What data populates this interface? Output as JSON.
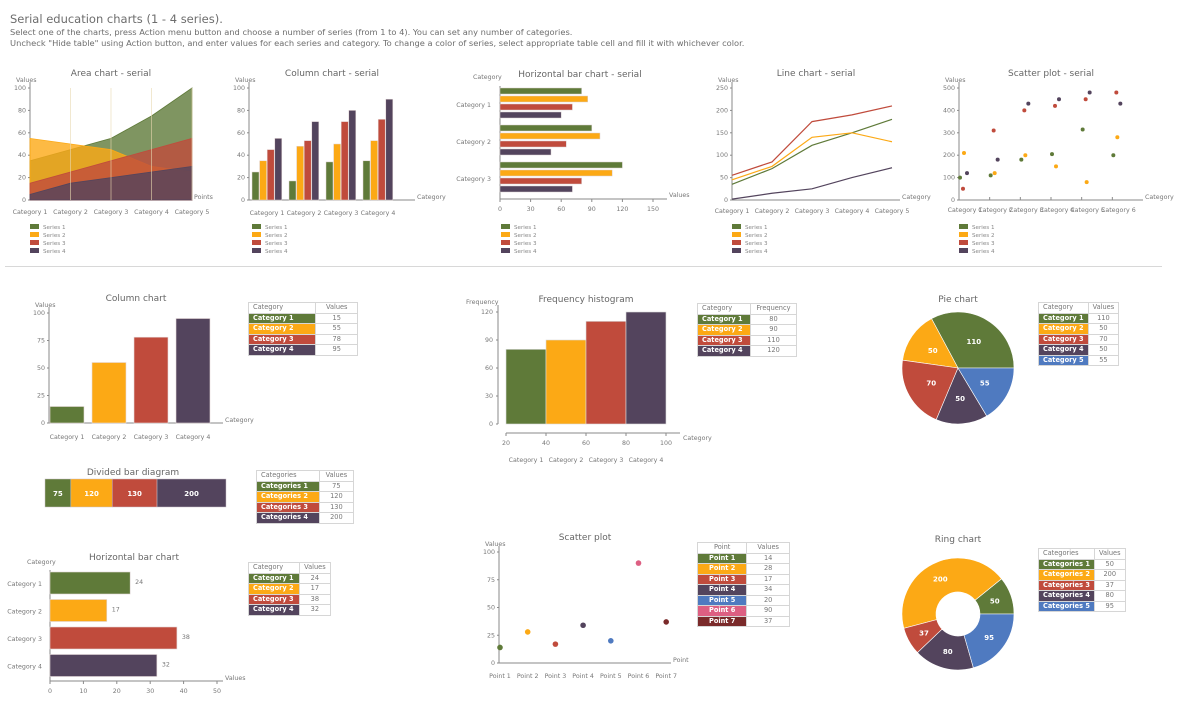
{
  "header": {
    "title": "Serial education charts (1 - 4 series).",
    "line1": "Select one of the charts, press Action menu button and choose a number of series (from 1 to 4). You can set any number of categories.",
    "line2": "Uncheck \"Hide table\" using Action button, and enter values for each series and category. To change a color of series, select appropriate table cell and fill it with whichever color."
  },
  "colors": {
    "green": "#5f7a39",
    "orange": "#fca915",
    "red": "#c04b3c",
    "purple": "#53445d",
    "blue": "#4f7ac0",
    "pink": "#dd5f82",
    "maroon": "#7a2a2a",
    "axis": "#8a8a8a"
  },
  "chart_data": [
    {
      "id": "area_serial",
      "type": "area",
      "title": "Area chart - serial",
      "ylabel": "Values",
      "xlabel": "Points",
      "ylim": [
        0,
        100
      ],
      "yticks": [
        0,
        20,
        40,
        60,
        80,
        100
      ],
      "categories": [
        "Category 1",
        "Category 2",
        "Category 3",
        "Category 4",
        "Category 5"
      ],
      "series": [
        {
          "name": "Series 1",
          "color": "#5f7a39",
          "values": [
            35,
            45,
            55,
            75,
            100
          ]
        },
        {
          "name": "Series 2",
          "color": "#fca915",
          "values": [
            55,
            50,
            45,
            30,
            25
          ]
        },
        {
          "name": "Series 3",
          "color": "#c04b3c",
          "values": [
            15,
            25,
            35,
            45,
            55
          ]
        },
        {
          "name": "Series 4",
          "color": "#53445d",
          "values": [
            5,
            15,
            20,
            25,
            30
          ]
        }
      ],
      "legend": "bottom-left"
    },
    {
      "id": "column_serial",
      "type": "bar",
      "title": "Column chart - serial",
      "ylabel": "Values",
      "xlabel": "Category",
      "ylim": [
        0,
        100
      ],
      "yticks": [
        0,
        20,
        40,
        60,
        80,
        100
      ],
      "categories": [
        "Category 1",
        "Category 2",
        "Category 3",
        "Category 4"
      ],
      "series": [
        {
          "name": "Series 1",
          "color": "#5f7a39",
          "values": [
            25,
            17,
            34,
            35
          ]
        },
        {
          "name": "Series 2",
          "color": "#fca915",
          "values": [
            35,
            48,
            50,
            53
          ]
        },
        {
          "name": "Series 3",
          "color": "#c04b3c",
          "values": [
            45,
            53,
            70,
            72
          ]
        },
        {
          "name": "Series 4",
          "color": "#53445d",
          "values": [
            55,
            70,
            80,
            90
          ]
        }
      ],
      "legend": "bottom-left"
    },
    {
      "id": "hbar_serial",
      "type": "bar",
      "orientation": "horizontal",
      "title": "Horizontal bar chart - serial",
      "ylabel": "Category",
      "xlabel": "Values",
      "xlim": [
        0,
        150
      ],
      "xticks": [
        0,
        30,
        60,
        90,
        120,
        150
      ],
      "categories": [
        "Category 1",
        "Category 2",
        "Category 3"
      ],
      "series": [
        {
          "name": "Series 1",
          "color": "#5f7a39",
          "values": [
            80,
            90,
            120
          ]
        },
        {
          "name": "Series 2",
          "color": "#fca915",
          "values": [
            86,
            98,
            110
          ]
        },
        {
          "name": "Series 3",
          "color": "#c04b3c",
          "values": [
            71,
            65,
            80
          ]
        },
        {
          "name": "Series 4",
          "color": "#53445d",
          "values": [
            60,
            50,
            71
          ]
        }
      ],
      "legend": "bottom-left"
    },
    {
      "id": "line_serial",
      "type": "line",
      "title": "Line chart - serial",
      "ylabel": "Values",
      "xlabel": "Category",
      "ylim": [
        0,
        250
      ],
      "yticks": [
        0,
        50,
        100,
        150,
        200,
        250
      ],
      "categories": [
        "Category 1",
        "Category 2",
        "Category 3",
        "Category 4",
        "Category 5"
      ],
      "series": [
        {
          "name": "Series 1",
          "color": "#5f7a39",
          "values": [
            35,
            70,
            122,
            150,
            180
          ]
        },
        {
          "name": "Series 2",
          "color": "#fca915",
          "values": [
            45,
            75,
            140,
            150,
            130
          ]
        },
        {
          "name": "Series 3",
          "color": "#c04b3c",
          "values": [
            55,
            85,
            175,
            190,
            210
          ]
        },
        {
          "name": "Series 4",
          "color": "#53445d",
          "values": [
            2,
            15,
            25,
            50,
            72
          ]
        }
      ],
      "legend": "bottom-left"
    },
    {
      "id": "scatter_serial",
      "type": "scatter",
      "title": "Scatter plot - serial",
      "ylabel": "Values",
      "xlabel": "Category",
      "ylim": [
        0,
        500
      ],
      "yticks": [
        0,
        100,
        200,
        300,
        400,
        500
      ],
      "categories": [
        "Category 1",
        "Category 2",
        "Category 3",
        "Category 4",
        "Category 5",
        "Category 6"
      ],
      "series": [
        {
          "name": "Series 1",
          "color": "#5f7a39",
          "values": [
            100,
            110,
            180,
            205,
            315,
            200
          ]
        },
        {
          "name": "Series 2",
          "color": "#fca915",
          "values": [
            210,
            120,
            200,
            150,
            80,
            280
          ]
        },
        {
          "name": "Series 3",
          "color": "#c04b3c",
          "values": [
            50,
            310,
            400,
            420,
            450,
            480
          ]
        },
        {
          "name": "Series 4",
          "color": "#53445d",
          "values": [
            120,
            180,
            430,
            450,
            480,
            430
          ]
        }
      ],
      "legend": "bottom-left"
    },
    {
      "id": "column",
      "type": "bar",
      "title": "Column chart",
      "ylabel": "Values",
      "xlabel": "Category",
      "ylim": [
        0,
        100
      ],
      "yticks": [
        0,
        25,
        50,
        75,
        100
      ],
      "table_headers": [
        "Category",
        "Values"
      ],
      "categories": [
        "Category 1",
        "Category 2",
        "Category 3",
        "Category 4"
      ],
      "values": [
        15,
        55,
        78,
        95
      ],
      "colors": [
        "#5f7a39",
        "#fca915",
        "#c04b3c",
        "#53445d"
      ]
    },
    {
      "id": "histogram",
      "type": "bar",
      "subtype": "histogram",
      "title": "Frequency histogram",
      "ylabel": "Frequency",
      "xlabel": "Category",
      "ylim": [
        0,
        120
      ],
      "yticks": [
        0,
        30,
        60,
        90,
        120
      ],
      "xticks": [
        20,
        40,
        60,
        80,
        100
      ],
      "table_headers": [
        "Category",
        "Frequency"
      ],
      "categories": [
        "Category 1",
        "Category 2",
        "Category 3",
        "Category 4"
      ],
      "values": [
        80,
        90,
        110,
        120
      ],
      "colors": [
        "#5f7a39",
        "#fca915",
        "#c04b3c",
        "#53445d"
      ]
    },
    {
      "id": "pie",
      "type": "pie",
      "title": "Pie chart",
      "table_headers": [
        "Category",
        "Values"
      ],
      "categories": [
        "Category 1",
        "Category 2",
        "Category 3",
        "Category 4",
        "Category 5"
      ],
      "values": [
        110,
        50,
        70,
        50,
        55
      ],
      "colors": [
        "#5f7a39",
        "#fca915",
        "#c04b3c",
        "#53445d",
        "#4f7ac0"
      ]
    },
    {
      "id": "divided_bar",
      "type": "bar",
      "subtype": "stacked-horizontal",
      "title": "Divided bar diagram",
      "table_headers": [
        "Categories",
        "Values"
      ],
      "categories": [
        "Categories 1",
        "Categories 2",
        "Categories 3",
        "Categories 4"
      ],
      "values": [
        75,
        120,
        130,
        200
      ],
      "colors": [
        "#5f7a39",
        "#fca915",
        "#c04b3c",
        "#53445d"
      ]
    },
    {
      "id": "hbar",
      "type": "bar",
      "orientation": "horizontal",
      "title": "Horizontal bar chart",
      "ylabel": "Category",
      "xlabel": "Values",
      "xlim": [
        0,
        50
      ],
      "xticks": [
        0,
        10,
        20,
        30,
        40,
        50
      ],
      "table_headers": [
        "Category",
        "Values"
      ],
      "categories": [
        "Category 1",
        "Category 2",
        "Category 3",
        "Category 4"
      ],
      "values": [
        24,
        17,
        38,
        32
      ],
      "colors": [
        "#5f7a39",
        "#fca915",
        "#c04b3c",
        "#53445d"
      ]
    },
    {
      "id": "scatter",
      "type": "scatter",
      "title": "Scatter plot",
      "ylabel": "Values",
      "xlabel": "Point",
      "ylim": [
        0,
        100
      ],
      "yticks": [
        0,
        25,
        50,
        75,
        100
      ],
      "table_headers": [
        "Point",
        "Values"
      ],
      "categories": [
        "Point 1",
        "Point 2",
        "Point 3",
        "Point 4",
        "Point 5",
        "Point 6",
        "Point 7"
      ],
      "values": [
        14,
        28,
        17,
        34,
        20,
        90,
        37
      ],
      "colors": [
        "#5f7a39",
        "#fca915",
        "#c04b3c",
        "#53445d",
        "#4f7ac0",
        "#dd5f82",
        "#7a2a2a"
      ]
    },
    {
      "id": "ring",
      "type": "pie",
      "subtype": "donut",
      "title": "Ring chart",
      "table_headers": [
        "Categories",
        "Values"
      ],
      "categories": [
        "Categories 1",
        "Categories 2",
        "Categories 3",
        "Categories 4",
        "Categories 5"
      ],
      "values": [
        50,
        200,
        37,
        80,
        95
      ],
      "colors": [
        "#5f7a39",
        "#fca915",
        "#c04b3c",
        "#53445d",
        "#4f7ac0"
      ]
    }
  ]
}
